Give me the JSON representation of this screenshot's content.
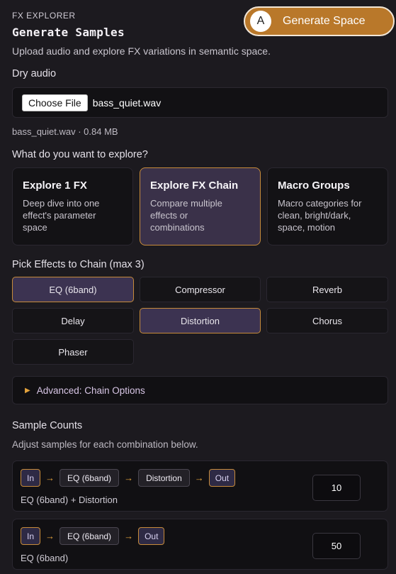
{
  "header": {
    "kicker": "FX EXPLORER",
    "title": "Generate Samples",
    "subtitle": "Upload audio and explore FX variations in semantic space.",
    "generate_badge": "A",
    "generate_label": "Generate Space",
    "accent_color": "#b9782a"
  },
  "dry_audio": {
    "label": "Dry audio",
    "choose_label": "Choose File",
    "file_name": "bass_quiet.wav",
    "file_meta": "bass_quiet.wav · 0.84 MB"
  },
  "explore": {
    "question": "What do you want to explore?",
    "modes": [
      {
        "title": "Explore 1 FX",
        "desc_lines": [
          "Deep dive into one",
          "effect's parameter",
          "space"
        ],
        "active": false
      },
      {
        "title": "Explore FX Chain",
        "desc_lines": [
          "Compare multiple",
          "effects or",
          "combinations"
        ],
        "active": true
      },
      {
        "title": "Macro Groups",
        "desc_lines": [
          "Macro categories for",
          "clean, bright/dark,",
          "space, motion"
        ],
        "active": false
      }
    ]
  },
  "effects": {
    "label": "Pick Effects to Chain (max 3)",
    "items": [
      {
        "name": "EQ (6band)",
        "selected": true
      },
      {
        "name": "Compressor",
        "selected": false
      },
      {
        "name": "Reverb",
        "selected": false
      },
      {
        "name": "Delay",
        "selected": false
      },
      {
        "name": "Distortion",
        "selected": true
      },
      {
        "name": "Chorus",
        "selected": false
      },
      {
        "name": "Phaser",
        "selected": false
      }
    ]
  },
  "advanced": {
    "label": "Advanced: Chain Options"
  },
  "samples": {
    "label": "Sample Counts",
    "hint": "Adjust samples for each combination below.",
    "combos": [
      {
        "chain": [
          "In",
          "EQ (6band)",
          "Distortion",
          "Out"
        ],
        "label": "EQ (6band) + Distortion",
        "count": "10"
      },
      {
        "chain": [
          "In",
          "EQ (6band)",
          "Out"
        ],
        "label": "EQ (6band)",
        "count": "50"
      }
    ],
    "arrow": "→"
  }
}
